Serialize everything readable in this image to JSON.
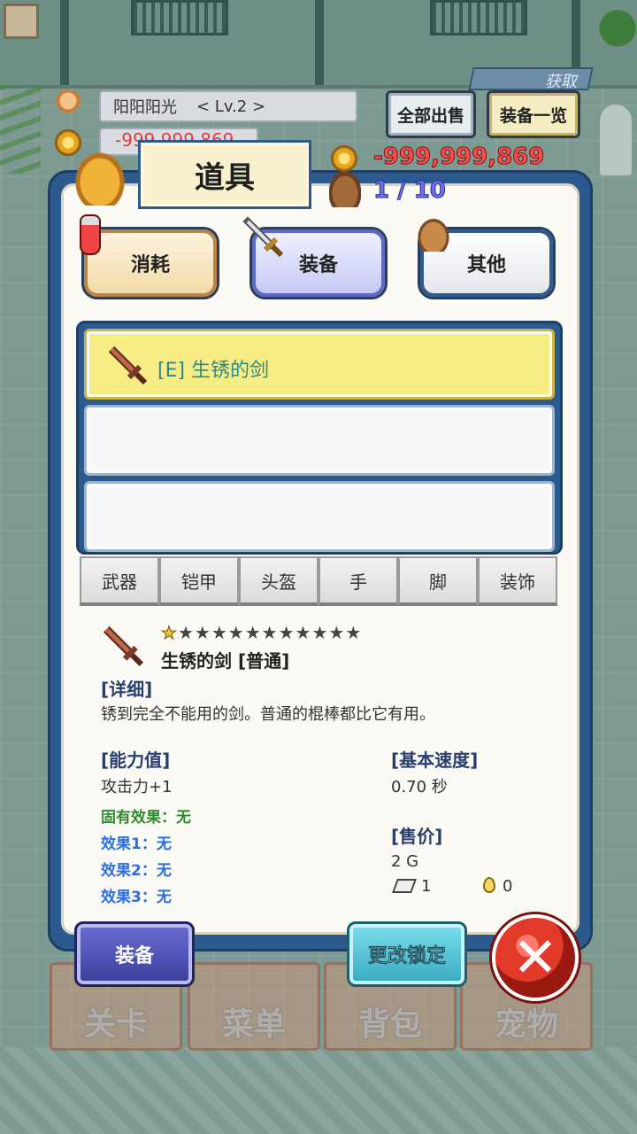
{
  "background_nav": [
    "关卡",
    "菜单",
    "背包",
    "宠物"
  ],
  "background_badge": "获取",
  "player": {
    "name": "阳阳阳光",
    "level": "< Lv.2 >",
    "money_back": "-999,999,869"
  },
  "header": {
    "sell_all_label": "全部出售",
    "equip_list_label": "装备一览",
    "gold": "-999,999,869",
    "bag_capacity": "1 / 10"
  },
  "panel": {
    "title": "道具",
    "categories": [
      {
        "label": "消耗",
        "icon": "potion-icon"
      },
      {
        "label": "装备",
        "icon": "sword-icon",
        "selected": true
      },
      {
        "label": "其他",
        "icon": "bag-icon"
      }
    ],
    "slots": [
      {
        "label": "[E] 生锈的剑",
        "icon": "sword-icon",
        "selected": true
      },
      {
        "label": ""
      },
      {
        "label": ""
      }
    ],
    "filters": [
      "武器",
      "铠甲",
      "头盔",
      "手",
      "脚",
      "装饰"
    ]
  },
  "detail": {
    "stars_filled": 1,
    "stars_total": 12,
    "name": "生锈的剑 [普通]",
    "detail_heading": "[详细]",
    "description": "锈到完全不能用的剑。普通的棍棒都比它有用。",
    "stats_heading": "[能力值]",
    "stat": "攻击力+1",
    "inherent_effect": "固有效果：无",
    "effect1": "效果1：无",
    "effect2": "效果2：无",
    "effect3": "效果3：无",
    "speed_heading": "[基本速度]",
    "speed": "0.70 秒",
    "price_heading": "[售价]",
    "price": "2 G",
    "gem_count": "1",
    "drop_count": "0"
  },
  "actions": {
    "equip_label": "装备",
    "change_lock_label": "更改锁定",
    "close_symbol": "✕"
  },
  "colors": {
    "panel_border": "#2c5a8e",
    "selected_slot": "#f8ec84",
    "gold_text": "#ff4d4d",
    "bag_text": "#6b6ff0",
    "effect_green": "#2f8a2f",
    "effect_blue": "#2a6ee0"
  }
}
